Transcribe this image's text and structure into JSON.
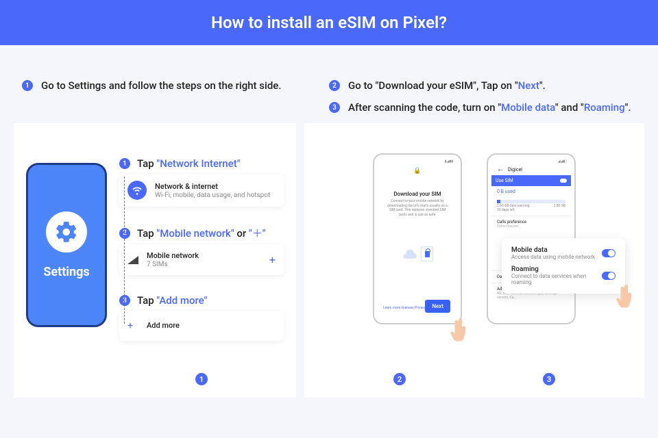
{
  "header": {
    "title": "How to install an eSIM on Pixel?"
  },
  "intro": {
    "left": {
      "num": "1",
      "text": "Go to Settings and follow the steps on the right side."
    },
    "right": [
      {
        "num": "2",
        "pre": "Go to \"Download your eSIM\", Tap on \"",
        "hl": "Next",
        "post": "\"."
      },
      {
        "num": "3",
        "pre": "After scanning the code, turn on \"",
        "hl1": "Mobile data",
        "mid": "\" and \"",
        "hl2": "Roaming",
        "post": "\"."
      }
    ]
  },
  "left_panel": {
    "phone_label": "Settings",
    "steps": [
      {
        "num": "1",
        "pre": "Tap ",
        "hl": "\"Network Internet\"",
        "card": {
          "title": "Network & internet",
          "sub": "Wi-Fi, mobile, data usage, and hotspot"
        }
      },
      {
        "num": "2",
        "pre": "Tap ",
        "hl": "\"Mobile network\"",
        "mid": " or ",
        "hl2": "\"＋\"",
        "card": {
          "title": "Mobile network",
          "sub": "7 SIMs",
          "plus": "+"
        }
      },
      {
        "num": "3",
        "pre": "Tap ",
        "hl": "\"Add more\"",
        "card": {
          "title": "Add more",
          "plus_left": "+"
        }
      }
    ],
    "badge": "1"
  },
  "right_panel": {
    "phone2": {
      "lock_top": "🔒",
      "title": "Download your SIM",
      "desc": "Connect to your mobile network by downloading the info that's usually on a SIM card. This replaces standard SIM cards and is just as safe.",
      "learn": "Learn more licenses Privacy polic",
      "next": "Next"
    },
    "phone3": {
      "carrier": "Digicel",
      "use_sim": "Use SIM",
      "used_label": "0 B used",
      "warn": "2.00 GB data warning",
      "warn2": "30 days left",
      "limit": "2.00 GB",
      "calls": {
        "t": "Calls preference",
        "s": "China Unicom"
      },
      "warnlimit": "Data warning & limit",
      "adv": {
        "t": "Advanced",
        "s": "4G, 5G, Preferred network type, Settings version, Ca..."
      }
    },
    "callout": {
      "row1": {
        "t": "Mobile data",
        "s": "Access data using mobile network"
      },
      "row2": {
        "t": "Roaming",
        "s": "Connect to data services when roaming"
      }
    },
    "badges": [
      "2",
      "3"
    ]
  }
}
